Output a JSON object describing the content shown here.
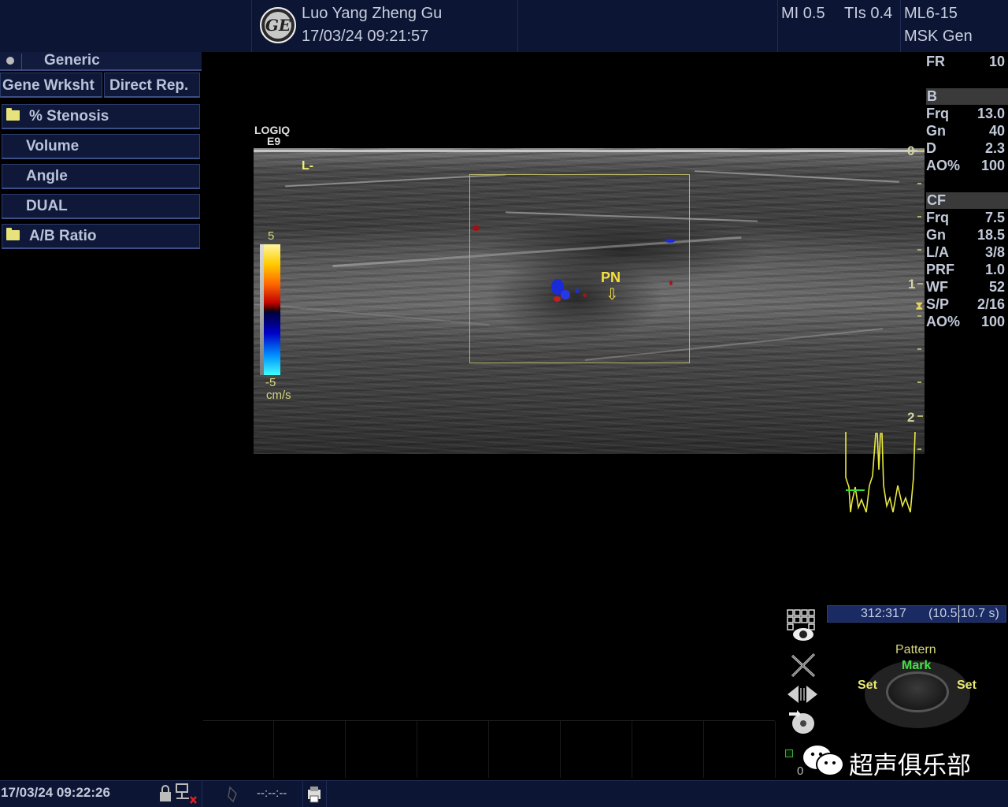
{
  "header": {
    "patient_name": "Luo Yang Zheng Gu",
    "datetime": "17/03/24 09:21:57",
    "mi": "MI 0.5",
    "tis": "TIs 0.4",
    "probe": "ML6-15",
    "preset": "MSK Gen",
    "logo_text": "GE"
  },
  "menu": {
    "title": "Generic",
    "tabs": [
      "Gene Wrksht",
      "Direct Rep."
    ],
    "items": [
      {
        "label": "% Stenosis",
        "icon": "folder-icon"
      },
      {
        "label": "Volume"
      },
      {
        "label": "Angle"
      },
      {
        "label": "DUAL"
      },
      {
        "label": "A/B Ratio",
        "icon": "folder-icon"
      }
    ]
  },
  "image": {
    "system_line1": "LOGIQ",
    "system_line2": "E9",
    "orientation_mark": "L-",
    "annotation": "PN",
    "annotation_arrow": "⇩",
    "color_scale_max": "5",
    "color_scale_min": "-5",
    "color_scale_unit": "cm/s",
    "depth_labels": [
      "0",
      "1",
      "2"
    ]
  },
  "params": {
    "fr_label": "FR",
    "fr_value": "10",
    "b_header": "B",
    "b": [
      {
        "k": "Frq",
        "v": "13.0"
      },
      {
        "k": "Gn",
        "v": "40"
      },
      {
        "k": "D",
        "v": "2.3"
      },
      {
        "k": "AO%",
        "v": "100"
      }
    ],
    "cf_header": "CF",
    "cf": [
      {
        "k": "Frq",
        "v": "7.5"
      },
      {
        "k": "Gn",
        "v": "18.5"
      },
      {
        "k": "L/A",
        "v": "3/8"
      },
      {
        "k": "PRF",
        "v": "1.0"
      },
      {
        "k": "WF",
        "v": "52"
      },
      {
        "k": "S/P",
        "v": "2/16"
      },
      {
        "k": "AO%",
        "v": "100"
      }
    ]
  },
  "cine": {
    "frames": "312:317",
    "time": "(10.5:10.7 s)"
  },
  "trackball": {
    "mode": "Pattern",
    "function": "Mark",
    "left": "Set",
    "right": "Set"
  },
  "small_counter": "0",
  "status": {
    "datetime": "17/03/24 09:22:26",
    "cine_indicator": "--:--:--"
  },
  "watermark": "超声俱乐部"
}
